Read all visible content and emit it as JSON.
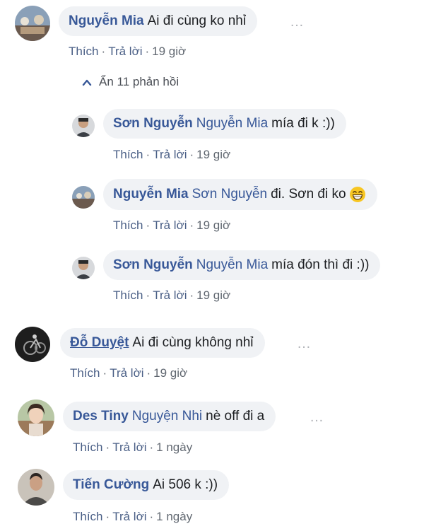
{
  "comments": [
    {
      "author": "Nguyễn Mia",
      "text": "Ai đi cùng ko nhỉ",
      "actions": {
        "like": "Thích",
        "reply": "Trả lời",
        "time": "19 giờ"
      },
      "more_icon": "…"
    },
    {
      "author": "Đỗ Duyệt",
      "text": "Ai đi cùng không nhỉ",
      "actions": {
        "like": "Thích",
        "reply": "Trả lời",
        "time": "19 giờ"
      },
      "more_icon": "…"
    },
    {
      "author": "Des Tiny",
      "mention": "Nguyện Nhi",
      "text": "nè off đi a",
      "actions": {
        "like": "Thích",
        "reply": "Trả lời",
        "time": "1 ngày"
      },
      "more_icon": "…"
    },
    {
      "author": "Tiến Cường",
      "text": "Ai 506 k :))",
      "actions": {
        "like": "Thích",
        "reply": "Trả lời",
        "time": "1 ngày"
      }
    }
  ],
  "replies_toggle": {
    "label": "Ẩn 11 phản hồi",
    "icon": "chevron-up-icon"
  },
  "replies": [
    {
      "author": "Sơn Nguyễn",
      "mention": "Nguyễn Mia",
      "text": "mía đi k :))",
      "actions": {
        "like": "Thích",
        "reply": "Trả lời",
        "time": "19 giờ"
      }
    },
    {
      "author": "Nguyễn Mia",
      "mention": "Sơn Nguyễn",
      "text": "đi. Sơn đi ko",
      "emoji": "grinning-face-emoji",
      "actions": {
        "like": "Thích",
        "reply": "Trả lời",
        "time": "19 giờ"
      }
    },
    {
      "author": "Sơn Nguyễn",
      "mention": "Nguyễn Mia",
      "text": "mía đón thì đi :))",
      "actions": {
        "like": "Thích",
        "reply": "Trả lời",
        "time": "19 giờ"
      }
    }
  ],
  "colors": {
    "name_link": "#385898",
    "bubble_bg": "#f0f2f5",
    "meta_text": "#606770",
    "more_dots": "#b0b3b8"
  }
}
